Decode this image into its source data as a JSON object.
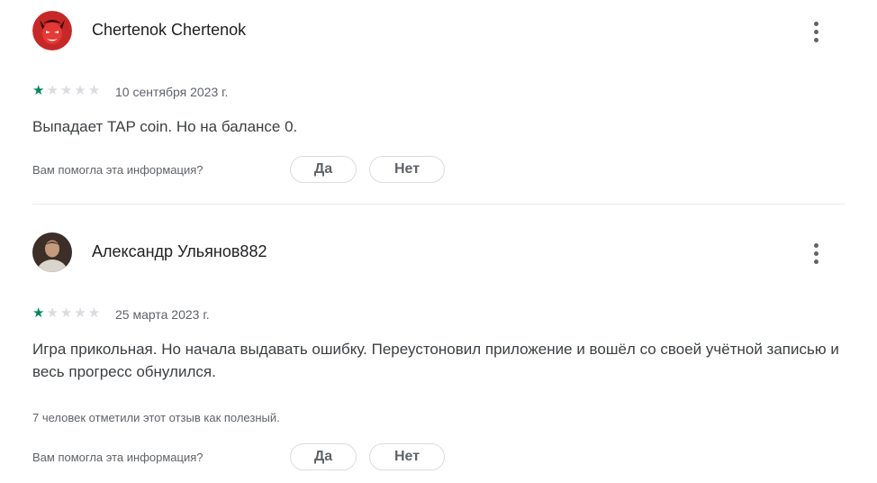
{
  "reviews": [
    {
      "author": "Chertenok Chertenok",
      "avatar_icon": "red-devil-avatar",
      "rating": 1,
      "max_rating": 5,
      "date": "10 сентября 2023 г.",
      "text": "Выпадает TAP coin. Но на балансе 0.",
      "helpful_count_text": "",
      "question": "Вам помогла эта информация?",
      "yes_label": "Да",
      "no_label": "Нет"
    },
    {
      "author": "Александр Ульянов882",
      "avatar_icon": "person-photo-avatar",
      "rating": 1,
      "max_rating": 5,
      "date": "25 марта 2023 г.",
      "text": "Игра прикольная. Но начала выдавать ошибку. Переустоновил приложение и вошёл со своей учётной записью и весь прогресс обнулился.",
      "helpful_count_text": "7 человек отметили этот отзыв как полезный.",
      "question": "Вам помогла эта информация?",
      "yes_label": "Да",
      "no_label": "Нет"
    }
  ],
  "colors": {
    "star_filled": "#01875f",
    "star_empty": "#dadce0",
    "text": "#3c4043",
    "secondary": "#5f6368",
    "border": "#dadce0"
  }
}
